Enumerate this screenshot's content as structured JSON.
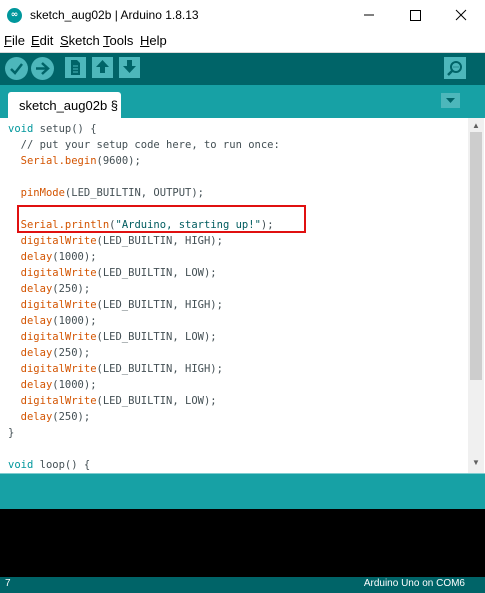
{
  "window": {
    "title": "sketch_aug02b | Arduino 1.8.13",
    "logo_text": "∞"
  },
  "menu": {
    "file": {
      "mnemonic": "F",
      "rest": "ile"
    },
    "edit": {
      "mnemonic": "E",
      "rest": "dit"
    },
    "sketch": {
      "mnemonic": "S",
      "rest": "ketch"
    },
    "tools": {
      "mnemonic": "T",
      "rest": "ools"
    },
    "help": {
      "mnemonic": "H",
      "rest": "elp"
    }
  },
  "toolbar": {
    "icons": [
      "verify-icon",
      "upload-icon",
      "new-icon",
      "open-icon",
      "save-icon",
      "serial-monitor-icon"
    ]
  },
  "tab": {
    "label": "sketch_aug02b §"
  },
  "code": {
    "l1_kw": "void",
    "l1_rest": " setup() {",
    "l2": "  // put your setup code here, to run once:",
    "l3_fn": "Serial",
    "l3_fn2": ".begin",
    "l3_rest": "(9600);",
    "l5_fn": "pinMode",
    "l5_rest": "(LED_BUILTIN, OUTPUT);",
    "l7_fn": "Serial",
    "l7_fn2": ".println",
    "l7_open": "(",
    "l7_str": "\"Arduino, starting up!\"",
    "l7_close": ");",
    "l8_fn": "digitalWrite",
    "l8_rest": "(LED_BUILTIN, HIGH);",
    "l9_fn": "delay",
    "l9_rest": "(1000);",
    "l10_fn": "digitalWrite",
    "l10_rest": "(LED_BUILTIN, LOW);",
    "l11_fn": "delay",
    "l11_rest": "(250);",
    "l12_fn": "digitalWrite",
    "l12_rest": "(LED_BUILTIN, HIGH);",
    "l13_fn": "delay",
    "l13_rest": "(1000);",
    "l14_fn": "digitalWrite",
    "l14_rest": "(LED_BUILTIN, LOW);",
    "l15_fn": "delay",
    "l15_rest": "(250);",
    "l16_fn": "digitalWrite",
    "l16_rest": "(LED_BUILTIN, HIGH);",
    "l17_fn": "delay",
    "l17_rest": "(1000);",
    "l18_fn": "digitalWrite",
    "l18_rest": "(LED_BUILTIN, LOW);",
    "l19_fn": "delay",
    "l19_rest": "(250);",
    "l20": "}",
    "l22_kw": "void",
    "l22_rest": " loop() {"
  },
  "status": {
    "line_number": "7",
    "board_port": "Arduino Uno on COM6"
  },
  "colors": {
    "toolbar": "#006468",
    "tabstrip": "#17a1a5",
    "button": "#4db7bb",
    "highlight": "#e01010"
  }
}
